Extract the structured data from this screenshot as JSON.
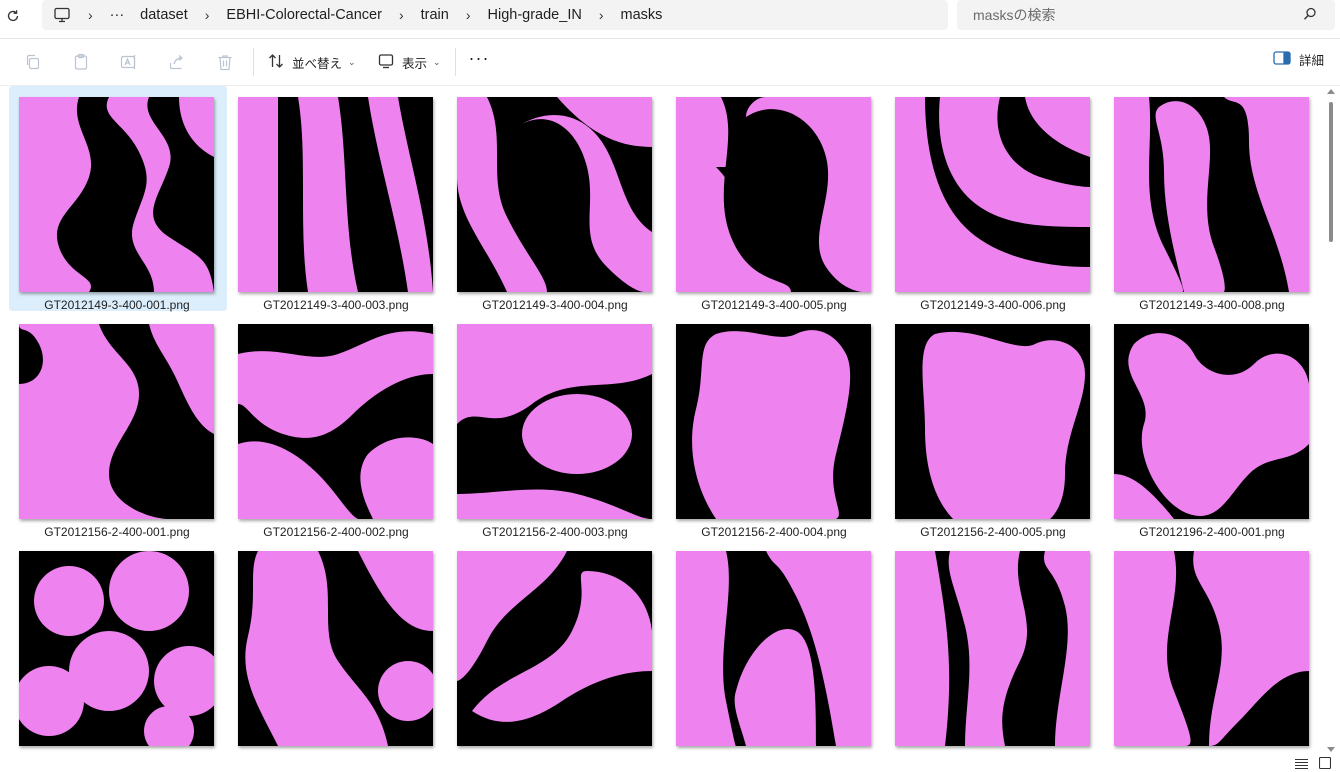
{
  "address": {
    "breadcrumb": [
      "dataset",
      "EBHI-Colorectal-Cancer",
      "train",
      "High-grade_IN",
      "masks"
    ],
    "overflow": "···",
    "search_placeholder": "masksの検索"
  },
  "toolbar": {
    "sort_label": "並べ替え",
    "view_label": "表示",
    "more_label": "···",
    "details_label": "詳細"
  },
  "colors": {
    "mask": "#ee82ee",
    "background": "#000000",
    "selection": "#dceefc"
  },
  "files": [
    {
      "name": "GT2012149-3-400-001.png",
      "selected": true
    },
    {
      "name": "GT2012149-3-400-003.png"
    },
    {
      "name": "GT2012149-3-400-004.png"
    },
    {
      "name": "GT2012149-3-400-005.png"
    },
    {
      "name": "GT2012149-3-400-006.png"
    },
    {
      "name": "GT2012149-3-400-008.png"
    },
    {
      "name": "GT2012156-2-400-001.png"
    },
    {
      "name": "GT2012156-2-400-002.png"
    },
    {
      "name": "GT2012156-2-400-003.png"
    },
    {
      "name": "GT2012156-2-400-004.png"
    },
    {
      "name": "GT2012156-2-400-005.png"
    },
    {
      "name": "GT2012196-2-400-001.png"
    },
    {
      "name": ""
    },
    {
      "name": ""
    },
    {
      "name": ""
    },
    {
      "name": ""
    },
    {
      "name": ""
    },
    {
      "name": ""
    }
  ]
}
